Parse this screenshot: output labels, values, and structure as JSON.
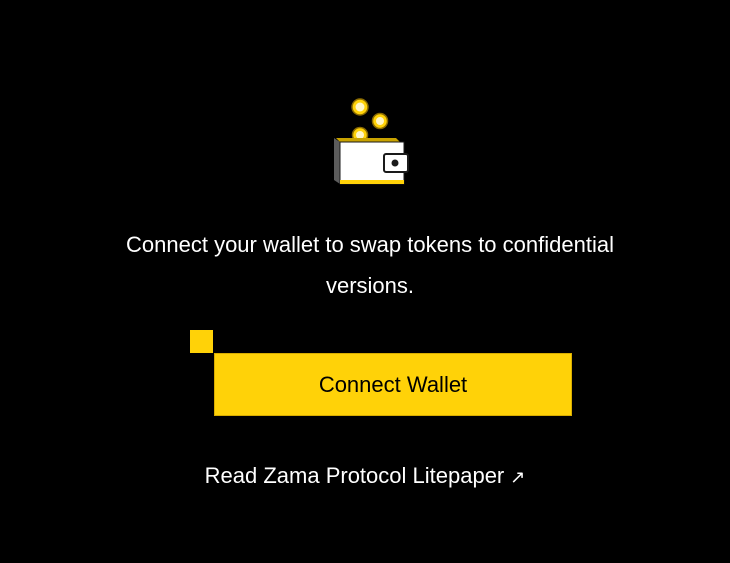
{
  "message": {
    "text": "Connect your wallet to swap tokens to confidential versions."
  },
  "connect_button": {
    "label": "Connect Wallet"
  },
  "litepaper_link": {
    "label": "Read Zama Protocol Litepaper",
    "arrow": "↗"
  },
  "colors": {
    "background": "#000000",
    "accent": "#FFD208",
    "text": "#ffffff"
  },
  "icons": {
    "illustration": "wallet-with-coins-icon",
    "link": "external-arrow-icon"
  }
}
